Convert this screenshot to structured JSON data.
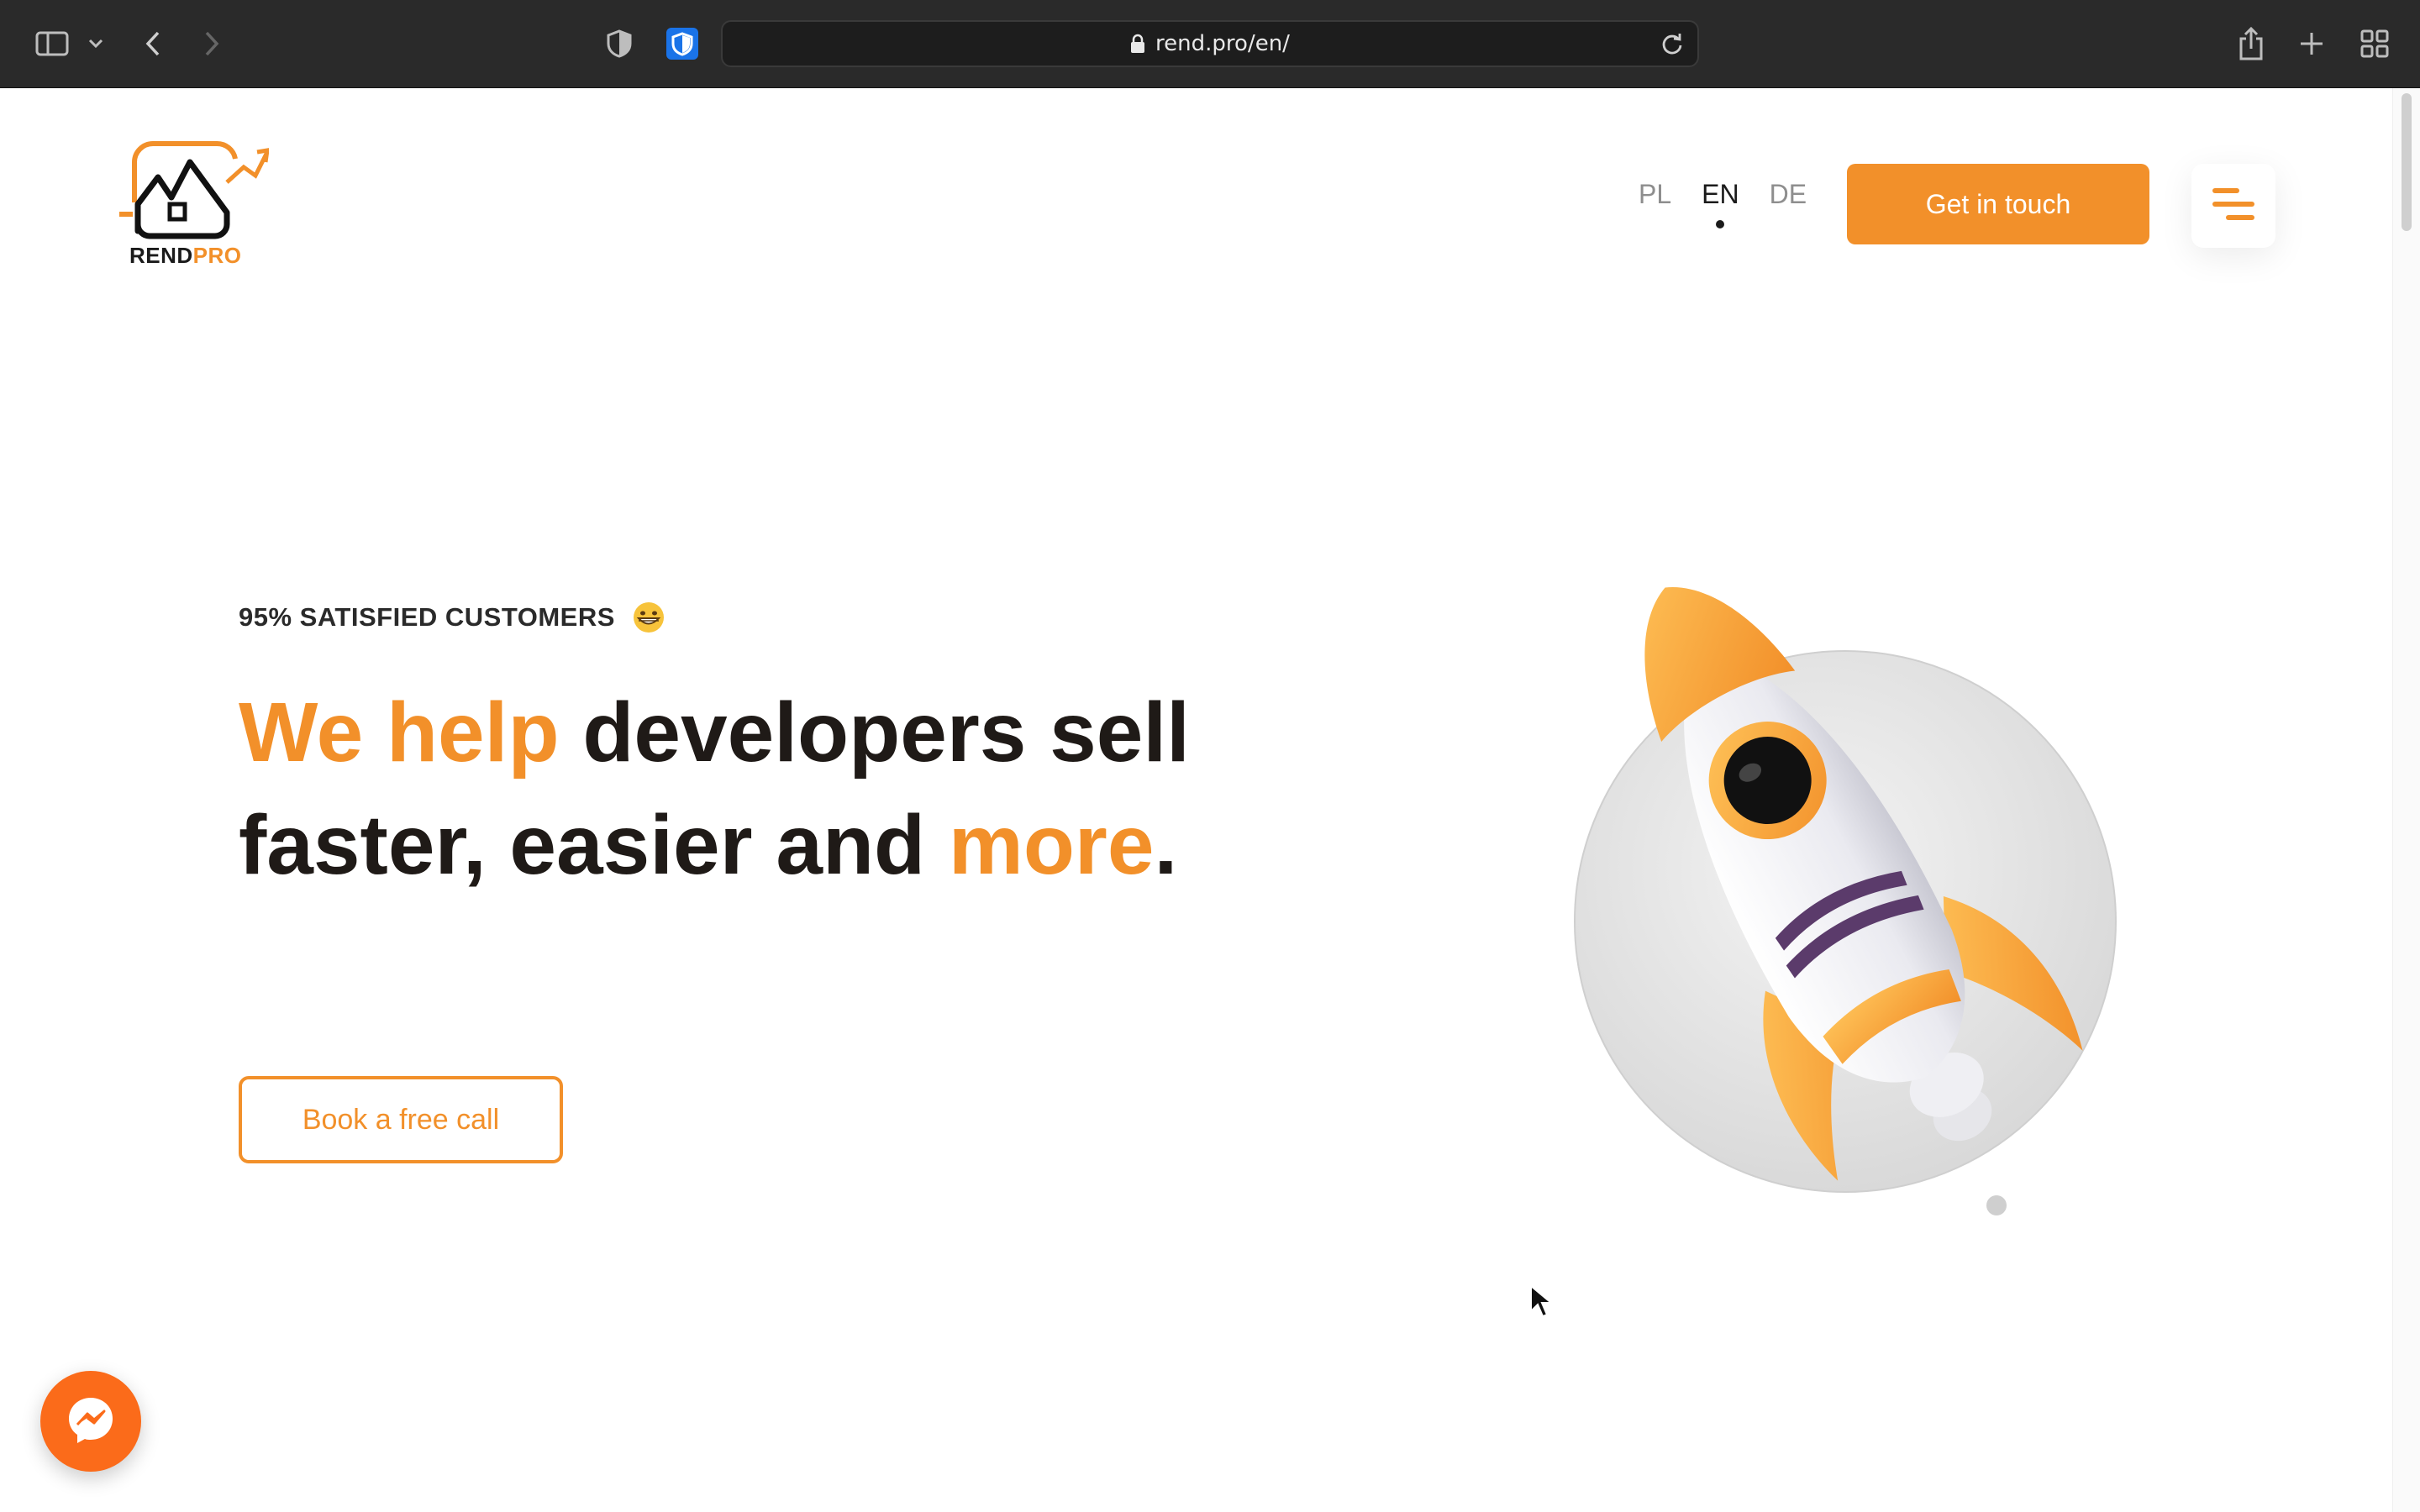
{
  "browser": {
    "url": "rend.pro/en/"
  },
  "header": {
    "logo_parts": [
      "REND",
      "PRO"
    ],
    "languages": [
      {
        "code": "PL",
        "active": false
      },
      {
        "code": "EN",
        "active": true
      },
      {
        "code": "DE",
        "active": false
      }
    ],
    "cta_label": "Get in touch"
  },
  "hero": {
    "eyebrow": "95% SATISFIED CUSTOMERS",
    "eyebrow_emoji": "grinning-face-icon",
    "headline_parts": [
      {
        "text": "We help ",
        "accent": true
      },
      {
        "text": "developers sell faster, easier and ",
        "accent": false
      },
      {
        "text": "more",
        "accent": true
      },
      {
        "text": ".",
        "accent": false
      }
    ],
    "button_label": "Book a free call"
  },
  "colors": {
    "accent": "#f2902a",
    "text": "#1f1a17",
    "messenger": "#fb6b1a",
    "chrome": "#2a2a2a"
  }
}
